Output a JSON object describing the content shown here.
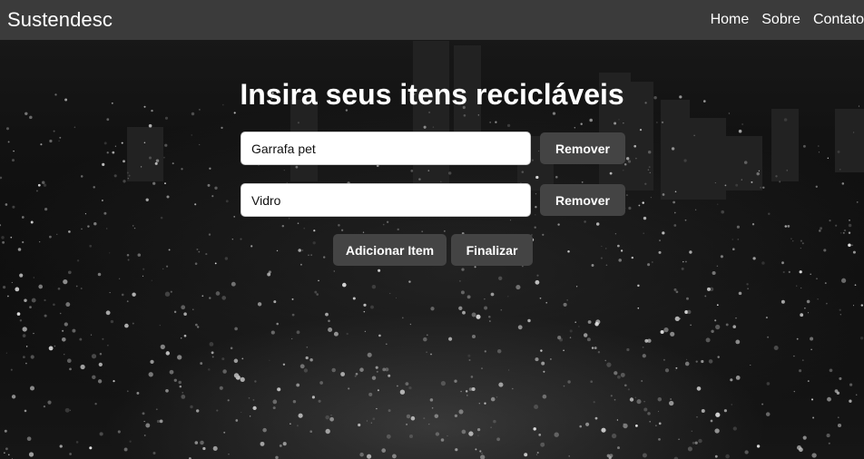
{
  "navbar": {
    "brand": "Sustendesc",
    "links": [
      {
        "label": "Home"
      },
      {
        "label": "Sobre"
      },
      {
        "label": "Contato"
      }
    ]
  },
  "main": {
    "title": "Insira seus itens recicláveis",
    "items": [
      {
        "value": "Garrafa pet",
        "remove_label": "Remover"
      },
      {
        "value": "Vidro",
        "remove_label": "Remover"
      }
    ],
    "add_label": "Adicionar Item",
    "finish_label": "Finalizar"
  },
  "colors": {
    "navbar_bg": "#3b3b3b",
    "button_bg": "#444444",
    "text": "#ffffff"
  }
}
